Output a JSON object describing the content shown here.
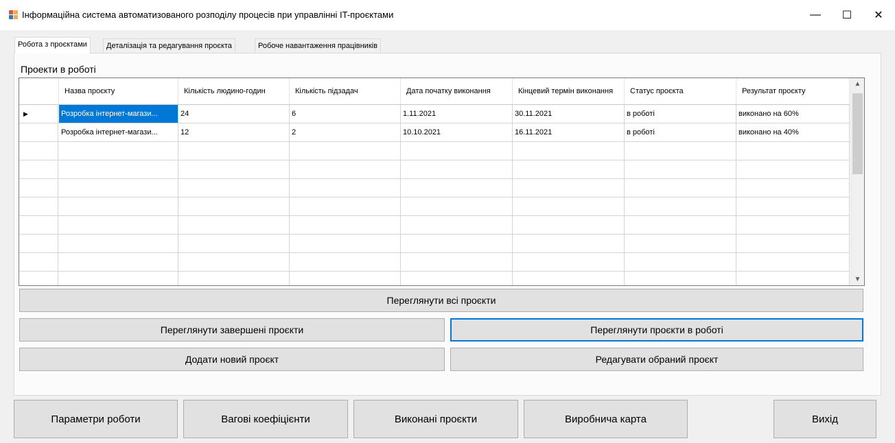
{
  "window": {
    "title": "Інформаційна система автоматизованого розподілу процесів при управлінні IT-проєктами",
    "controls": [
      "—",
      "☐",
      "✕"
    ]
  },
  "tabs": [
    {
      "label": "Робота з проєктами",
      "active": true
    },
    {
      "label": "Деталізація та редагування проєкта",
      "active": false
    },
    {
      "label": "Робоче навантаження працівників",
      "active": false
    }
  ],
  "section_label": "Проекти в роботі",
  "table": {
    "columns": [
      "Назва проєкту",
      "Кількість людино-годин",
      "Кількість підзадач",
      "Дата початку виконання",
      "Кінцевий термін виконання",
      "Статус проєкта",
      "Результат проєкту"
    ],
    "rows": [
      [
        "Розробка інтернет-магази...",
        "24",
        "6",
        "1.11.2021",
        "30.11.2021",
        "в роботі",
        "виконано на 60%"
      ],
      [
        "Розробка інтернет-магази...",
        "12",
        "2",
        "10.10.2021",
        "16.11.2021",
        "в роботі",
        "виконано на 40%"
      ]
    ],
    "current_row_marker": "▶"
  },
  "buttons": {
    "view_all": "Переглянути всі проєкти",
    "view_finished": "Переглянути завершені проєкти",
    "view_in_progress": "Переглянути проєкти в роботі",
    "add_new": "Додати новий проєкт",
    "edit_selected": "Редагувати обраний проєкт"
  },
  "bottom_buttons": {
    "work_params": "Параметри роботи",
    "weights": "Вагові коефіцієнти",
    "completed_projects": "Виконані проєкти",
    "production_map": "Виробнича карта",
    "exit": "Вихід"
  },
  "colors": {
    "selection": "#0078d7",
    "focus_border": "#0078d7"
  }
}
